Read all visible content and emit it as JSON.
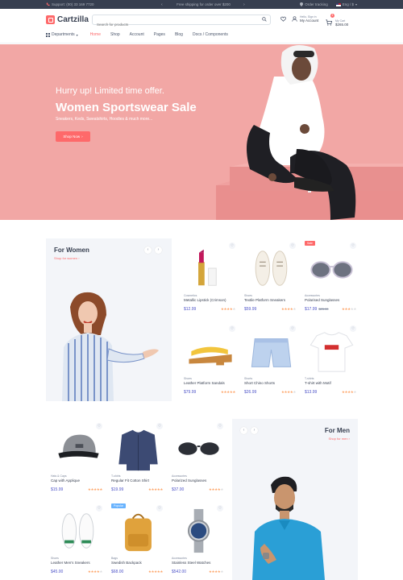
{
  "topbar": {
    "support": "Support: (00) 33 169 7720",
    "promo": "Free shipping for order over $200",
    "order_tracking": "Order tracking",
    "locale": "Eng / $"
  },
  "header": {
    "logo": "Cartzilla",
    "search_placeholder": "Search for products",
    "account_small": "Hello, Sign in",
    "account_label": "My Account",
    "cart_small": "My Cart",
    "cart_total": "$265.00",
    "cart_count": "4"
  },
  "nav": {
    "departments": "Departments",
    "items": [
      "Home",
      "Shop",
      "Account",
      "Pages",
      "Blog",
      "Docs / Components"
    ]
  },
  "hero": {
    "line1": "Hurry up! Limited time offer.",
    "title": "Women Sportswear Sale",
    "subtitle": "Sneakers, Keds, Sweatshirts, Hoodies & much more...",
    "button": "Shop Now"
  },
  "women": {
    "title": "For Women",
    "link": "Shop for women",
    "products": [
      {
        "cat": "Cosmetics",
        "name": "Metallic Lipstick (Crimson)",
        "price": "$12.99",
        "old": "",
        "rating": 4,
        "tag": ""
      },
      {
        "cat": "Shoes",
        "name": "Textile Platform Sneakers",
        "price": "$59.99",
        "old": "",
        "rating": 4,
        "tag": ""
      },
      {
        "cat": "Accessories",
        "name": "Polarised Sunglasses",
        "price": "$17.99",
        "old": "$25.00",
        "rating": 3,
        "tag": "Sale"
      },
      {
        "cat": "Shoes",
        "name": "Leather Platform Sandals",
        "price": "$79.99",
        "old": "",
        "rating": 5,
        "tag": ""
      },
      {
        "cat": "Shorts",
        "name": "Short Chino Shorts",
        "price": "$26.99",
        "old": "",
        "rating": 4,
        "tag": ""
      },
      {
        "cat": "T-shirts",
        "name": "T-shirt with Motif",
        "price": "$13.99",
        "old": "",
        "rating": 4,
        "tag": ""
      }
    ]
  },
  "men": {
    "title": "For Men",
    "link": "Shop for men",
    "products": [
      {
        "cat": "Hats & Caps",
        "name": "Cap with Applique",
        "price": "$15.99",
        "old": "",
        "rating": 5,
        "tag": ""
      },
      {
        "cat": "T-shirts",
        "name": "Regular Fit Cotton Shirt",
        "price": "$19.99",
        "old": "",
        "rating": 5,
        "tag": ""
      },
      {
        "cat": "Accessories",
        "name": "Polarized Sunglasses",
        "price": "$37.00",
        "old": "",
        "rating": 4,
        "tag": ""
      },
      {
        "cat": "Shoes",
        "name": "Leather Men's Sneakers",
        "price": "$45.00",
        "old": "",
        "rating": 4,
        "tag": ""
      },
      {
        "cat": "Bags",
        "name": "Swedish Backpack",
        "price": "$68.00",
        "old": "",
        "rating": 5,
        "tag": "Popular"
      },
      {
        "cat": "Accessories",
        "name": "Stainless Steel Watches",
        "price": "$542.00",
        "old": "",
        "rating": 4,
        "tag": ""
      }
    ]
  },
  "colors": {
    "accent": "#fe696a",
    "price": "#4e54c8",
    "hero_bg": "#f2a7a5",
    "dark": "#373f50",
    "star": "#fea569"
  }
}
